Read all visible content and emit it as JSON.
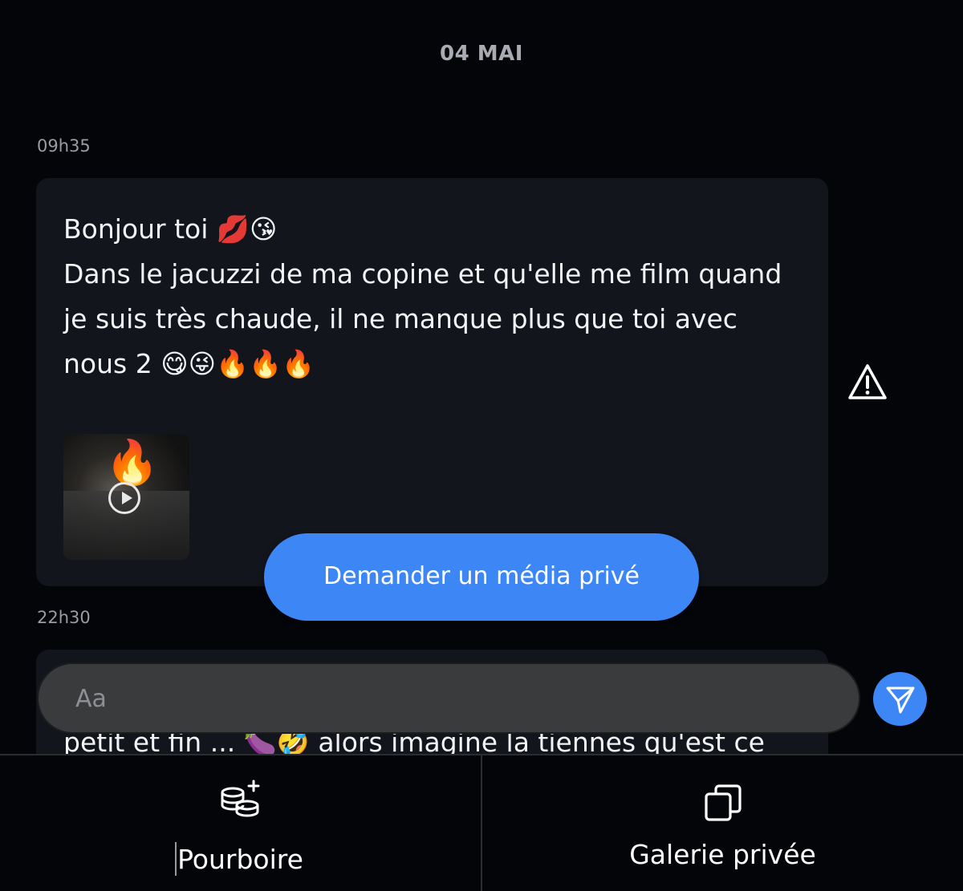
{
  "date_separator": "04 MAI",
  "messages": [
    {
      "time": "09h35",
      "text": "Bonjour toi 💋😘\nDans le jacuzzi de ma copine et qu'elle me film quand je suis très chaude, il ne manque plus que toi avec nous 2 😋😜🔥🔥🔥",
      "media": {
        "icon": "fire",
        "overlay": "play-icon"
      }
    },
    {
      "time": "22h30",
      "text": "petit et fin ... 🍆🤣 alors imagine la tiennes qu'est ce"
    }
  ],
  "request_media_button": "Demander un média privé",
  "composer": {
    "placeholder": "Aa"
  },
  "bottom_nav": {
    "tip_label": "Pourboire",
    "gallery_label": "Galerie privée"
  },
  "colors": {
    "background": "#040509",
    "bubble": "#13151d",
    "accent": "#3d86f5",
    "input": "#3a3b3d"
  }
}
